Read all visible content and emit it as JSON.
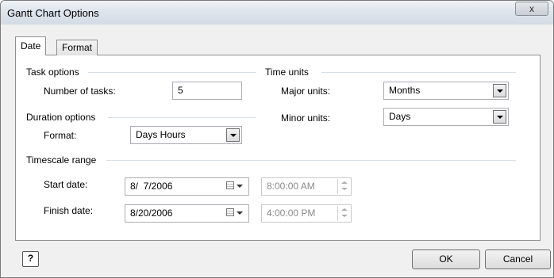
{
  "window": {
    "title": "Gantt Chart Options",
    "close_icon": "x"
  },
  "tabs": [
    {
      "label": "Date"
    },
    {
      "label": "Format"
    }
  ],
  "task_options": {
    "heading": "Task options",
    "number_label": "Number of tasks:",
    "number_value": "5"
  },
  "duration_options": {
    "heading": "Duration options",
    "format_label": "Format:",
    "format_value": "Days Hours"
  },
  "time_units": {
    "heading": "Time units",
    "major_label": "Major units:",
    "major_value": "Months",
    "minor_label": "Minor units:",
    "minor_value": "Days"
  },
  "timescale": {
    "heading": "Timescale range",
    "start_label": "Start date:",
    "start_date": "8/  7/2006",
    "start_time": "8:00:00 AM",
    "finish_label": "Finish date:",
    "finish_date": "8/20/2006",
    "finish_time": "4:00:00 PM"
  },
  "footer": {
    "help_glyph": "?",
    "ok_label": "OK",
    "cancel_label": "Cancel"
  }
}
